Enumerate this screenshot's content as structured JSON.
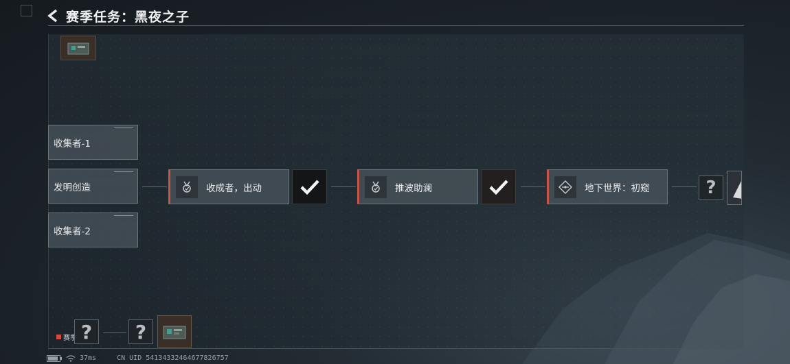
{
  "header": {
    "title": "赛季任务：黑夜之子"
  },
  "icons": {
    "back": "back-arrow-icon",
    "medal": "medal-icon",
    "target": "target-icon",
    "check": "check-icon",
    "question": "question-mark-icon",
    "crate": "crate-icon"
  },
  "side_branches": [
    {
      "label": "收集者-1"
    },
    {
      "label": "发明创造"
    },
    {
      "label": "收集者-2"
    }
  ],
  "quest_chain": [
    {
      "label": "收成者，出动",
      "completed": true
    },
    {
      "label": "推波助澜",
      "completed": true
    },
    {
      "label": "地下世界：初窥",
      "completed": false
    }
  ],
  "locked_symbol": "?",
  "legend": {
    "label": "赛季",
    "color": "#d04a3e"
  },
  "status_bar": {
    "ping": "37ms",
    "uid": "CN UID 54134332464677826757"
  },
  "colors": {
    "accent": "#c65447",
    "complete_bg": "#141516"
  }
}
